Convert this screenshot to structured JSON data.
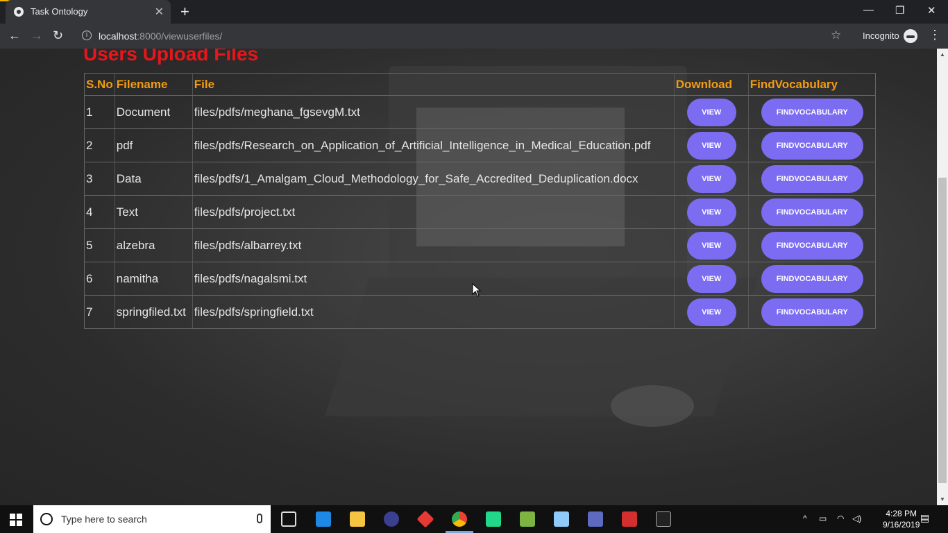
{
  "browser": {
    "tab_title": "Task Ontology",
    "url_host": "localhost",
    "url_rest": ":8000/viewuserfiles/",
    "incognito_label": "Incognito"
  },
  "page": {
    "heading": "Users Upload Files",
    "columns": [
      "S.No",
      "Filename",
      "File",
      "Download",
      "FindVocabulary"
    ],
    "rows": [
      {
        "sno": "1",
        "filename": "Document",
        "file": "files/pdfs/meghana_fgsevgM.txt"
      },
      {
        "sno": "2",
        "filename": "pdf",
        "file": "files/pdfs/Research_on_Application_of_Artificial_Intelligence_in_Medical_Education.pdf"
      },
      {
        "sno": "3",
        "filename": "Data",
        "file": "files/pdfs/1_Amalgam_Cloud_Methodology_for_Safe_Accredited_Deduplication.docx"
      },
      {
        "sno": "4",
        "filename": "Text",
        "file": "files/pdfs/project.txt"
      },
      {
        "sno": "5",
        "filename": "alzebra",
        "file": "files/pdfs/albarrey.txt"
      },
      {
        "sno": "6",
        "filename": "namitha",
        "file": "files/pdfs/nagalsmi.txt"
      },
      {
        "sno": "7",
        "filename": "springfiled.txt",
        "file": "files/pdfs/springfield.txt"
      }
    ],
    "view_label": "VIEW",
    "vocab_label": "FINDVOCABULARY"
  },
  "taskbar": {
    "search_placeholder": "Type here to search",
    "time": "4:28 PM",
    "date": "9/16/2019"
  },
  "colors": {
    "heading": "#e8161b",
    "header_text": "#f39c12",
    "button": "#7b6cf2"
  }
}
